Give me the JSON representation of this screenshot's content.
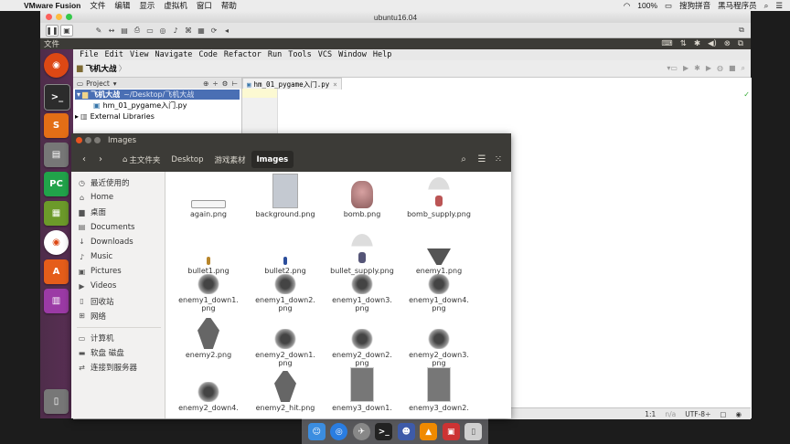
{
  "mac_menubar": {
    "app": "VMware Fusion",
    "menus": [
      "文件",
      "编辑",
      "显示",
      "虚拟机",
      "窗口",
      "帮助"
    ],
    "battery": "100%",
    "input_method": "搜狗拼音",
    "user": "黑马程序员"
  },
  "vm_window": {
    "title": "ubuntu16.04"
  },
  "ubuntu_panel": {
    "menu": "文件"
  },
  "pycharm": {
    "menus": [
      "File",
      "Edit",
      "View",
      "Navigate",
      "Code",
      "Refactor",
      "Run",
      "Tools",
      "VCS",
      "Window",
      "Help"
    ],
    "nav_project": "飞机大战",
    "project_label": "Project",
    "tree": {
      "root": "飞机大战",
      "root_path": "~/Desktop/飞机大战",
      "file": "hm_01_pygame入门.py",
      "libs": "External Libraries"
    },
    "tab": "hm_01_pygame入门.py",
    "status": {
      "pos": "1:1",
      "sep": "n/a",
      "enc": "UTF-8÷"
    }
  },
  "nautilus": {
    "title": "Images",
    "breadcrumbs": [
      "主文件夹",
      "Desktop",
      "游戏素材",
      "Images"
    ],
    "sidebar": [
      {
        "icon": "clock-icon",
        "label": "最近使用的"
      },
      {
        "icon": "home-icon",
        "label": "Home"
      },
      {
        "icon": "folder-icon",
        "label": "桌面"
      },
      {
        "icon": "document-icon",
        "label": "Documents"
      },
      {
        "icon": "download-icon",
        "label": "Downloads"
      },
      {
        "icon": "music-icon",
        "label": "Music"
      },
      {
        "icon": "picture-icon",
        "label": "Pictures"
      },
      {
        "icon": "video-icon",
        "label": "Videos"
      },
      {
        "icon": "trash-icon",
        "label": "回收站"
      },
      {
        "icon": "network-icon",
        "label": "网络"
      }
    ],
    "sidebar2": [
      {
        "icon": "computer-icon",
        "label": "计算机"
      },
      {
        "icon": "drive-icon",
        "label": "软盘 磁盘"
      },
      {
        "icon": "server-icon",
        "label": "连接到服务器"
      }
    ],
    "files": [
      [
        "again.png",
        "background.png",
        "bomb.png",
        "bomb_supply.png"
      ],
      [
        "bullet1.png",
        "bullet2.png",
        "bullet_supply.png",
        "enemy1.png"
      ],
      [
        "enemy1_down1.\npng",
        "enemy1_down2.\npng",
        "enemy1_down3.\npng",
        "enemy1_down4.\npng"
      ],
      [
        "enemy2.png",
        "enemy2_down1.\npng",
        "enemy2_down2.\npng",
        "enemy2_down3.\npng"
      ],
      [
        "enemy2_down4.",
        "enemy2_hit.png",
        "enemy3_down1.",
        "enemy3_down2."
      ]
    ]
  },
  "colors": {
    "ubuntu_panel": "#3c3b37",
    "launcher": "#5a2f55",
    "accent": "#e95420"
  }
}
